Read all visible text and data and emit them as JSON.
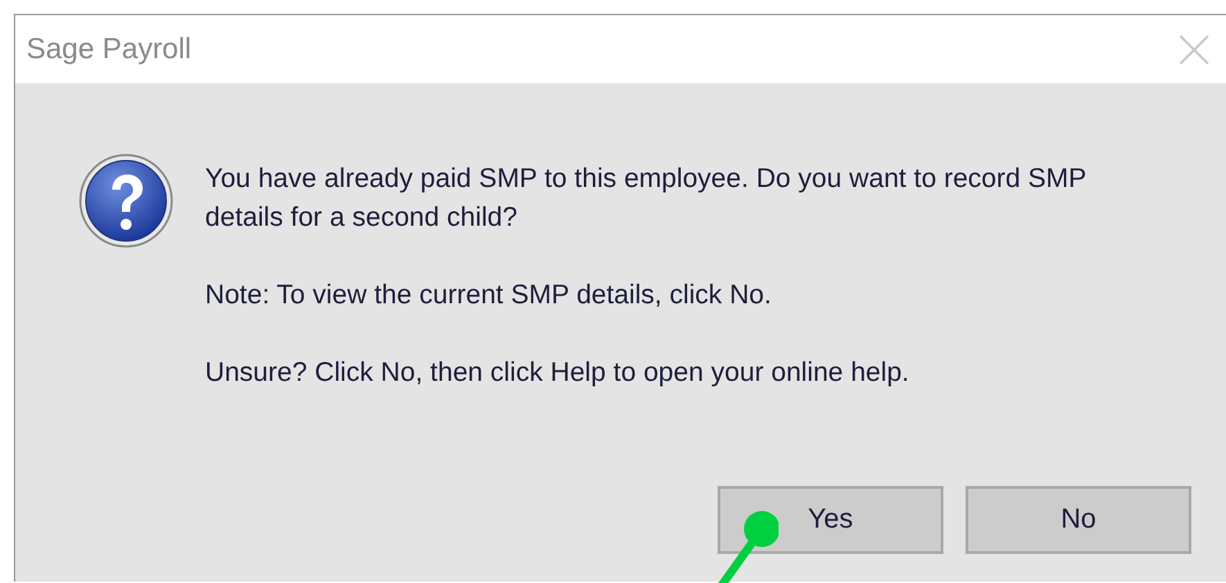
{
  "window": {
    "title": "Sage Payroll"
  },
  "message": {
    "lines": [
      "You have already paid SMP to this employee. Do you want to record SMP details for a second child?",
      "Note: To view the current SMP details, click No.",
      "Unsure? Click No, then click Help to open your online help."
    ]
  },
  "buttons": [
    {
      "label": "Yes",
      "selected": false
    },
    {
      "label": "No",
      "selected": false
    }
  ]
}
